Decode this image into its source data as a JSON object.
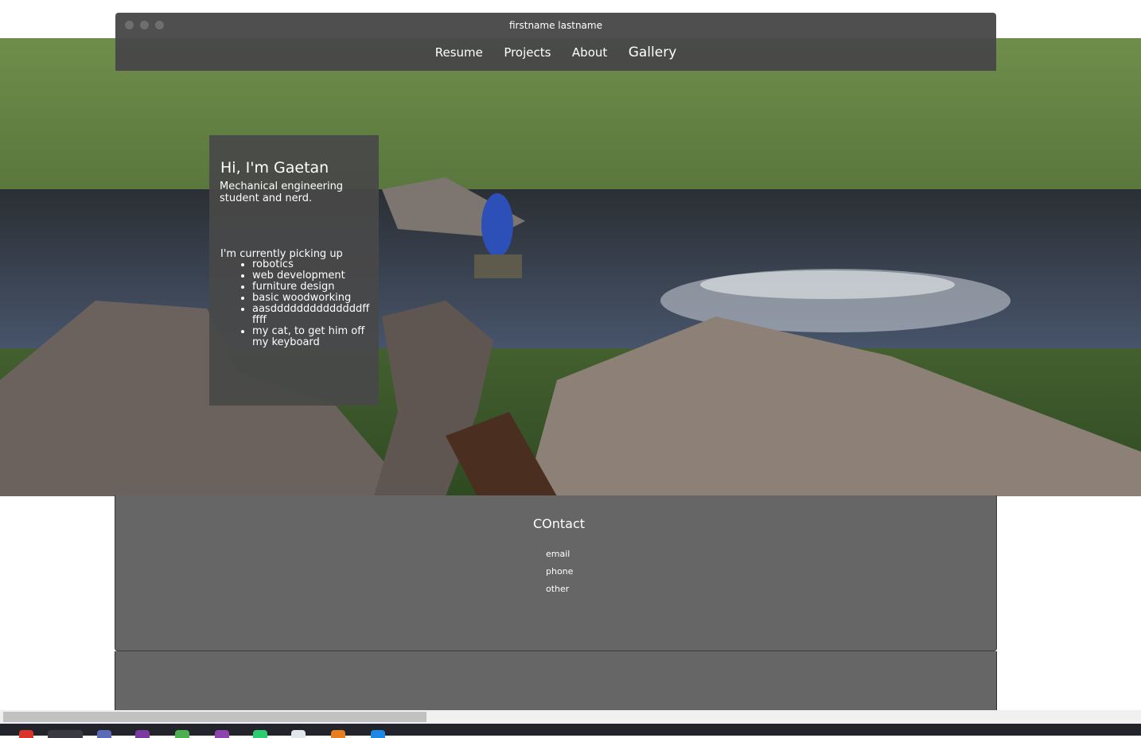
{
  "window": {
    "title": "firstname lastname"
  },
  "nav": {
    "items": [
      "Resume",
      "Projects",
      "About",
      "Gallery"
    ]
  },
  "intro": {
    "heading": "Hi, I'm Gaetan",
    "subtitle": "Mechanical engineering student and nerd.",
    "picking_label": "I'm currently picking up",
    "items": [
      "robotics",
      "web development",
      "furniture design",
      "basic woodworking",
      "aasddddddddddddddffffff",
      "my cat, to get him off my keyboard"
    ]
  },
  "contact": {
    "heading": "COntact",
    "items": [
      "email",
      "phone",
      "other"
    ]
  },
  "colors": {
    "panel": "#484848",
    "contact_bg": "#666666",
    "text": "#ffffff"
  }
}
